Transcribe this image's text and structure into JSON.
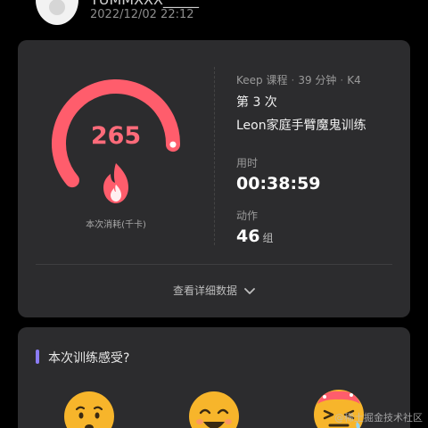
{
  "header": {
    "username": "YUMMXXX_____ ",
    "timestamp": "2022/12/02 22:12"
  },
  "summary": {
    "calories_value": "265",
    "calories_label": "本次消耗(千卡)",
    "meta_source": "Keep 课程",
    "meta_duration": "39 分钟",
    "meta_level": "K4",
    "count_text": "第 3 次",
    "course_name": "Leon家庭手臂魔鬼训练",
    "time_label": "用时",
    "time_value": "00:38:59",
    "moves_label": "动作",
    "moves_value": "46",
    "moves_unit": "组",
    "details_label": "查看详细数据",
    "calories_progress": 0.85,
    "accent_color": "#ff5d6c"
  },
  "feeling": {
    "title": "本次训练感受?",
    "accent_color": "#8b7cf6"
  },
  "watermark": "@稀土掘金技术社区"
}
